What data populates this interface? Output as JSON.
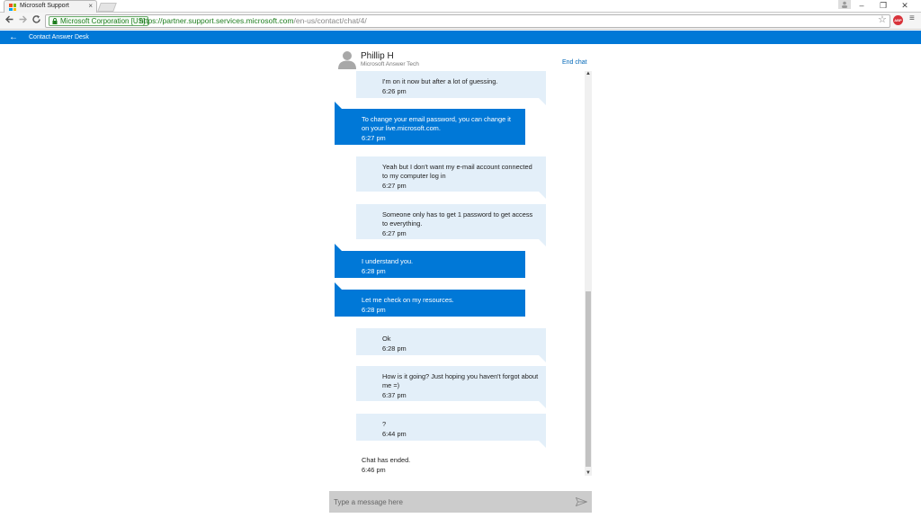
{
  "browser": {
    "tab_title": "Microsoft Support",
    "tab_close": "×",
    "site_identity": "Microsoft Corporation [US]",
    "url_scheme_host": "https://partner.support.services.microsoft.com",
    "url_path": "/en-us/contact/chat/4/",
    "controls": {
      "minimize": "–",
      "restore": "❐",
      "close": "✕"
    },
    "icons": [
      "back-icon",
      "forward-icon",
      "reload-icon",
      "lock-icon",
      "star-icon",
      "adblock-icon",
      "menu-icon"
    ],
    "adblock_label": "ABP"
  },
  "header": {
    "title": "Contact Answer Desk",
    "back_label": "←",
    "background": "#0078d7"
  },
  "agent": {
    "name": "Phillip H",
    "role": "Microsoft Answer Tech",
    "end_chat_label": "End chat"
  },
  "messages": [
    {
      "from": "user",
      "text": "I'm on it now but after a lot of guessing.",
      "time": "6:26 pm"
    },
    {
      "from": "agent",
      "text": "To change your email password, you can change it on your live.microsoft.com.",
      "time": "6:27 pm"
    },
    {
      "from": "user",
      "text": "Yeah but I don't want my e-mail account connected to my computer log in",
      "time": "6:27 pm"
    },
    {
      "from": "user",
      "text": "Someone only has to get 1 password to get access to everything.",
      "time": "6:27 pm"
    },
    {
      "from": "agent",
      "text": "I understand you.",
      "time": "6:28 pm"
    },
    {
      "from": "agent",
      "text": "Let me check on my resources.",
      "time": "6:28 pm"
    },
    {
      "from": "user",
      "text": "Ok",
      "time": "6:28 pm"
    },
    {
      "from": "user",
      "text": "How is it going? Just hoping you haven't forgot about me =)",
      "time": "6:37 pm"
    },
    {
      "from": "user",
      "text": "?",
      "time": "6:44 pm"
    }
  ],
  "system_message": {
    "text": "Chat has ended.",
    "time": "6:46 pm"
  },
  "composer": {
    "placeholder": "Type a message here"
  },
  "colors": {
    "agent_bubble": "#0078d7",
    "user_bubble": "#e3eff9",
    "composer": "#cccccc"
  }
}
